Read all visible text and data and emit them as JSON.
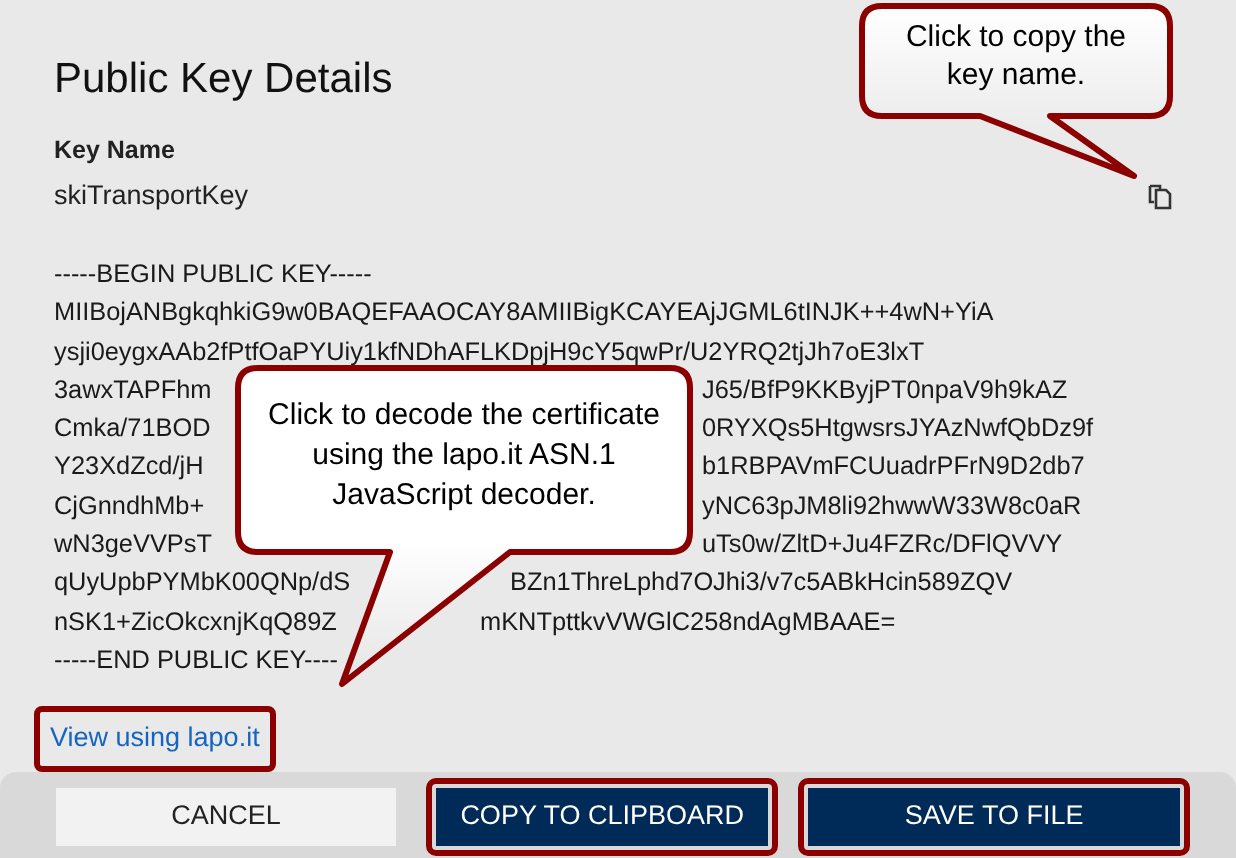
{
  "dialog": {
    "title": "Public Key Details",
    "key_name_label": "Key Name",
    "key_name": "skiTransportKey",
    "key_lines": [
      {
        "parts": [
          "-----BEGIN PUBLIC KEY-----"
        ]
      },
      {
        "parts": [
          "MIIBojANBgkqhkiG9w0BAQEFAAOCAY8AMIIBigKCAYEAjJGML6tINJK++4wN+YiA"
        ]
      },
      {
        "parts": [
          "ysji0eygxAAb2fPtfOaPYUiy1kfNDhAFLKDpjH9cY5qwPr/U2YRQ2tjJh7oE3lxT"
        ]
      },
      {
        "parts": [
          "3awxTAPFhm",
          "J65/BfP9KKByjPT0npaV9h9kAZ"
        ]
      },
      {
        "parts": [
          "Cmka/71BOD",
          "0RYXQs5HtgwsrsJYAzNwfQbDz9f"
        ]
      },
      {
        "parts": [
          "Y23XdZcd/jH",
          "b1RBPAVmFCUuadrPFrN9D2db7"
        ]
      },
      {
        "parts": [
          "CjGnndhMb+",
          "yNC63pJM8li92hwwW33W8c0aR"
        ]
      },
      {
        "parts": [
          "wN3geVVPsT",
          "uTs0w/ZltD+Ju4FZRc/DFlQVVY"
        ]
      },
      {
        "parts": [
          "qUyUpbPYMbK00QNp/dS",
          "BZn1ThreLphd7OJhi3/v7c5ABkHcin589ZQV"
        ]
      },
      {
        "parts": [
          "nSK1+ZicOkcxnjKqQ89Z",
          "mKNTpttkvVWGlC258ndAgMBAAE="
        ]
      },
      {
        "parts": [
          "-----END PUBLIC KEY----"
        ]
      }
    ],
    "link": {
      "label": "View using lapo.it",
      "highlighted": true
    },
    "buttons": [
      {
        "label": "CANCEL",
        "kind": "secondary",
        "highlighted": false
      },
      {
        "label": "COPY TO CLIPBOARD",
        "kind": "primary",
        "highlighted": true
      },
      {
        "label": "SAVE TO FILE",
        "kind": "primary",
        "highlighted": true
      }
    ]
  },
  "callouts": [
    "Click to copy the key name.",
    "Click to decode the certificate using the lapo.it ASN.1 JavaScript decoder."
  ]
}
